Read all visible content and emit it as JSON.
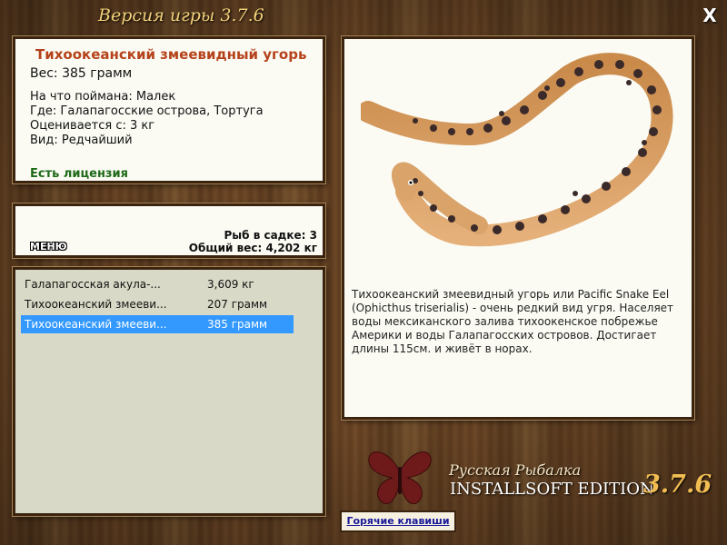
{
  "window": {
    "title": "Версия игры 3.7.6",
    "close_label": "X"
  },
  "fish": {
    "name": "Тихоокеанский змеевидный угорь",
    "weight": "Вес: 385 грамм",
    "caught_on": "На что поймана: Малек",
    "where": "Где: Галапагосские острова, Тортуга",
    "valued_from": "Оценивается с: 3 кг",
    "kind": "Вид: Редчайший",
    "license": "Есть лицензия",
    "description": "Тихоокеанский змеевидный угорь или Pacific Snake Eel (Ophicthus triserialis) - очень редкий вид угря. Населяет воды мексиканского залива тихоокенское побрежье Америки и воды Галапагосских островов. Достигает длины 115см. и живёт в норах."
  },
  "stats": {
    "menu_label": "МЕНЮ",
    "fish_in_cage": "Рыб в садке: 3",
    "total_weight": "Общий вес: 4,202 кг"
  },
  "catch_list": [
    {
      "name": "Галапагосская акула-...",
      "weight": "3,609 кг",
      "selected": false
    },
    {
      "name": "Тихоокеанский змееви...",
      "weight": "207 грамм",
      "selected": false
    },
    {
      "name": "Тихоокеанский змееви...",
      "weight": "385 грамм",
      "selected": true
    }
  ],
  "branding": {
    "line1": "Русская Рыбалка",
    "line2": "INSTALLSOFT EDITION",
    "version": "3.7.6"
  },
  "hotkeys_label": "Горячие клавиши",
  "colors": {
    "fish_name": "#b5421a",
    "license": "#1e6a17",
    "selection": "#3399ff",
    "title_gold": "#f2d27a",
    "version_gold": "#f2bd52"
  }
}
